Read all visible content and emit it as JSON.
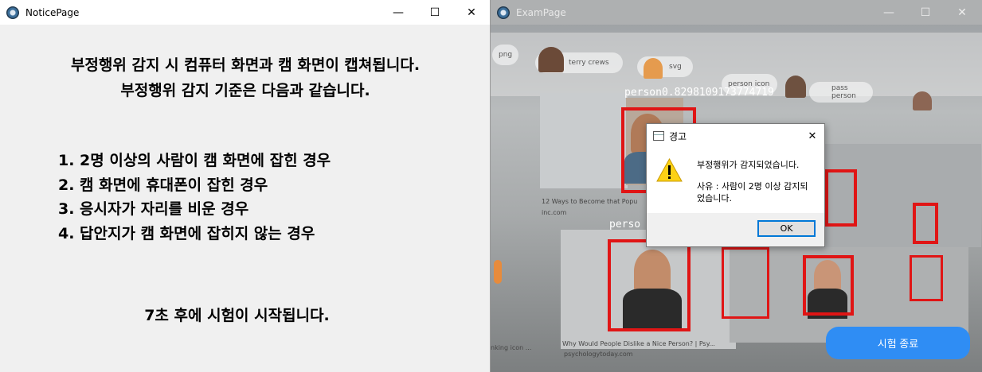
{
  "notice_window": {
    "title": "NoticePage",
    "heading_line1": "부정행위 감지 시 컴퓨터 화면과 캠 화면이 캡쳐됩니다.",
    "heading_line2": "부정행위 감지 기준은 다음과 같습니다.",
    "rules": [
      "1. 2명 이상의 사람이 캠 화면에 잡힌 경우",
      "2. 캠 화면에 휴대폰이 잡힌 경우",
      "3. 응시자가 자리를 비운 경우",
      "4. 답안지가 캠 화면에 잡히지 않는 경우"
    ],
    "countdown": "7초 후에 시험이 시작됩니다."
  },
  "exam_window": {
    "title": "ExamPage",
    "detection_label": "person0.8298109173774719",
    "detection_label_2": "perso",
    "end_button": "시험 종료",
    "background_captions": {
      "chip_png": "png",
      "chip_terry": "terry crews",
      "chip_svg": "svg",
      "chip_person_icon": "person icon",
      "chip_pass": "pass person",
      "cap_vect": "12 Ways to Become that Popu",
      "cap_inc": "inc.com",
      "cap_dislike": "Why Would People Dislike a Nice Person? | Psy...",
      "cap_psych": "psychologytoday.com",
      "cap_thinking": "nking icon ..."
    }
  },
  "dialog": {
    "title": "경고",
    "message": "부정행위가 감지되었습니다.",
    "reason": "사유 : 사람이 2명 이상 감지되었습니다.",
    "ok_label": "OK"
  },
  "caption_glyphs": {
    "minimize": "—",
    "maximize": "☐",
    "close": "✕"
  },
  "colors": {
    "bbox": "#e01515",
    "end_button": "#2f8df4",
    "notice_bg": "#f0f0f0"
  }
}
